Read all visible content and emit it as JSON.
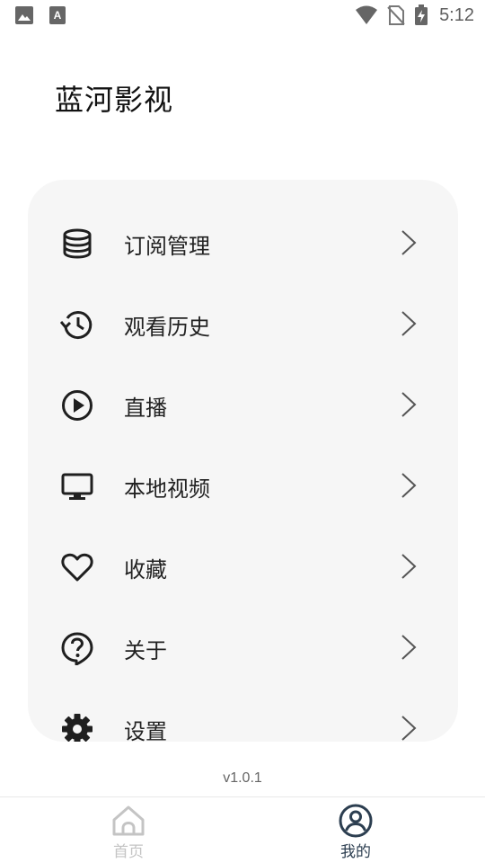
{
  "status_bar": {
    "time": "5:12",
    "icons": [
      "gallery-icon",
      "keyboard-a-icon",
      "wifi-icon",
      "no-sim-icon",
      "battery-charging-icon"
    ]
  },
  "app": {
    "title": "蓝河影视",
    "version": "v1.0.1"
  },
  "menu": {
    "items": [
      {
        "label": "订阅管理",
        "icon": "database-icon"
      },
      {
        "label": "观看历史",
        "icon": "history-icon"
      },
      {
        "label": "直播",
        "icon": "play-circle-icon"
      },
      {
        "label": "本地视频",
        "icon": "monitor-icon"
      },
      {
        "label": "收藏",
        "icon": "heart-icon"
      },
      {
        "label": "关于",
        "icon": "help-bubble-icon"
      },
      {
        "label": "设置",
        "icon": "gear-icon"
      }
    ]
  },
  "bottom_nav": {
    "tabs": [
      {
        "label": "首页",
        "icon": "home-icon",
        "active": false
      },
      {
        "label": "我的",
        "icon": "user-circle-icon",
        "active": true
      }
    ]
  },
  "colors": {
    "card_bg": "#f6f6f6",
    "active_tab": "#2c3e50",
    "inactive_tab": "#c4c4c4",
    "icon": "#1f1f1f"
  }
}
